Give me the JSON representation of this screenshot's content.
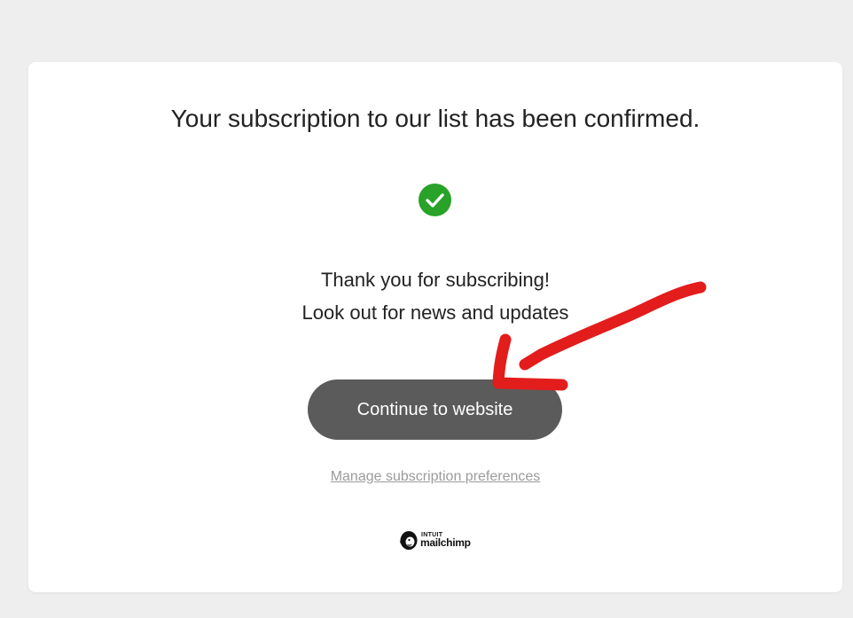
{
  "page": {
    "title": "Your subscription to our list has been confirmed.",
    "message_line1": "Thank you for subscribing!",
    "message_line2": "Look out for news and updates",
    "continue_label": "Continue to website",
    "manage_label": "Manage subscription preferences"
  },
  "brand": {
    "intuit": "INTUIT",
    "mailchimp": "mailchimp"
  },
  "icons": {
    "success": "check-circle-icon",
    "logo": "mailchimp-freddie-icon",
    "annotation": "red-hand-drawn-arrow"
  },
  "colors": {
    "background": "#eeeeee",
    "card": "#ffffff",
    "success_green": "#28a228",
    "button": "#5b5b5b",
    "link": "#9b9b9b",
    "annotation_red": "#e31c1c"
  }
}
